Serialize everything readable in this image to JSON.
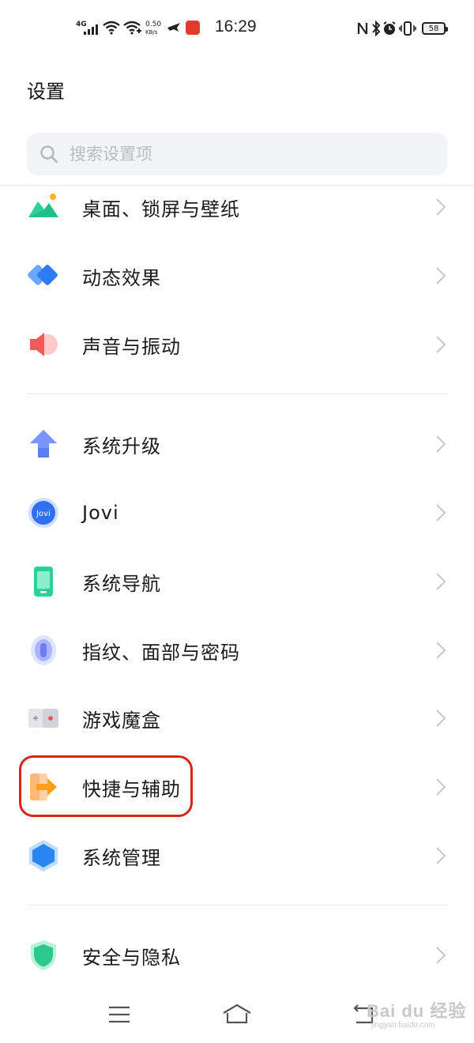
{
  "status_bar": {
    "network": "4G",
    "speed_value": "0.50",
    "speed_unit": "KB/s",
    "time": "16:29",
    "battery": "58"
  },
  "header": {
    "title": "设置"
  },
  "search": {
    "placeholder": "搜索设置项"
  },
  "items": [
    {
      "label": "桌面、锁屏与壁纸",
      "icon": "wallpaper-icon",
      "color": "#2fc48a"
    },
    {
      "label": "动态效果",
      "icon": "dynamic-effects-icon",
      "color": "#2d7cf6"
    },
    {
      "label": "声音与振动",
      "icon": "sound-icon",
      "color": "#f25a5a"
    },
    {
      "label": "系统升级",
      "icon": "system-upgrade-icon",
      "color": "#5b7ff2"
    },
    {
      "label": "Jovi",
      "icon": "jovi-icon",
      "color": "#2f6ff0"
    },
    {
      "label": "系统导航",
      "icon": "system-navigation-icon",
      "color": "#2ecf98"
    },
    {
      "label": "指纹、面部与密码",
      "icon": "fingerprint-icon",
      "color": "#7e8cf7"
    },
    {
      "label": "游戏魔盒",
      "icon": "game-box-icon",
      "color": "#d9dbe2"
    },
    {
      "label": "快捷与辅助",
      "icon": "shortcuts-icon",
      "color": "#ff9f1a"
    },
    {
      "label": "系统管理",
      "icon": "system-management-icon",
      "color": "#2a86f0"
    },
    {
      "label": "安全与隐私",
      "icon": "security-privacy-icon",
      "color": "#2cc98c"
    }
  ],
  "highlight_color": "#d9241c",
  "nav_bar": {
    "menu": "menu-icon",
    "home": "home-icon",
    "back": "back-icon"
  },
  "watermark": {
    "text": "Bai du 经验",
    "sub": "jingyan.baidu.com"
  }
}
